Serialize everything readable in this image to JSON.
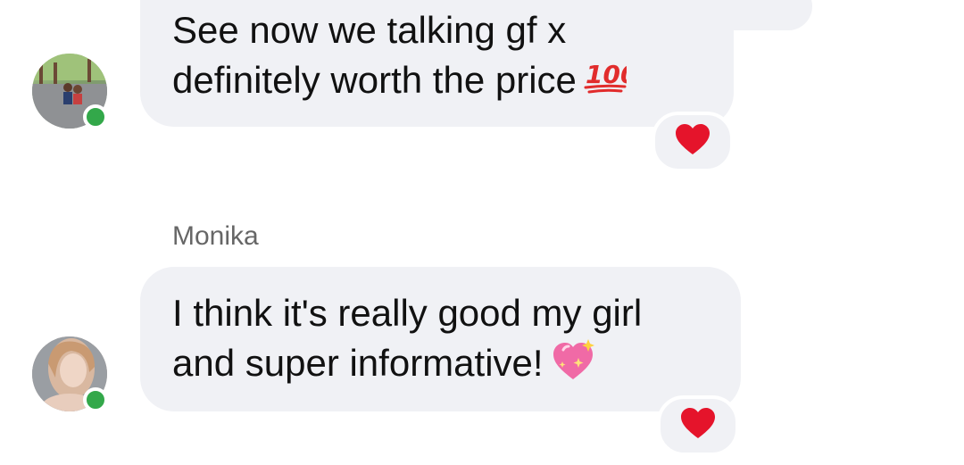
{
  "messages": [
    {
      "sender": "",
      "lines": [
        "See now we talking gf x",
        "definitely worth the price"
      ],
      "emoji": "hundred-points-icon",
      "reaction": "red-heart-icon",
      "online": true
    },
    {
      "sender": "Monika",
      "lines": [
        "I think it's really good my girl",
        "and super informative!"
      ],
      "emoji": "sparkling-heart-icon",
      "reaction": "red-heart-icon",
      "online": true
    }
  ],
  "colors": {
    "bubble": "#f0f1f5",
    "presence": "#33a84a",
    "heart": "#e5142b",
    "sparkling_heart": "#f06aa6",
    "hundred": "#e12c2c",
    "sender_name": "#666666"
  }
}
